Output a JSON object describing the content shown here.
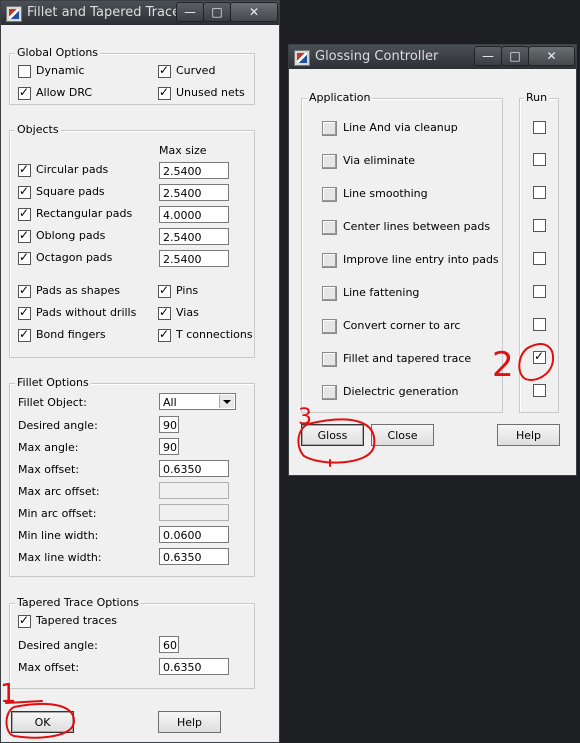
{
  "fillet_window": {
    "title": "Fillet and Tapered Trace",
    "global_options": {
      "label": "Global Options",
      "dynamic": "Dynamic",
      "curved": "Curved",
      "allow_drc": "Allow DRC",
      "unused_nets": "Unused nets"
    },
    "objects": {
      "label": "Objects",
      "max_size_header": "Max size",
      "rows": [
        {
          "label": "Circular pads",
          "value": "2.5400",
          "checked": true
        },
        {
          "label": "Square pads",
          "value": "2.5400",
          "checked": true
        },
        {
          "label": "Rectangular pads",
          "value": "4.0000",
          "checked": true
        },
        {
          "label": "Oblong pads",
          "value": "2.5400",
          "checked": true
        },
        {
          "label": "Octagon pads",
          "value": "2.5400",
          "checked": true
        }
      ],
      "pads_as_shapes": "Pads as shapes",
      "pins": "Pins",
      "pads_without_drills": "Pads without drills",
      "vias": "Vias",
      "bond_fingers": "Bond fingers",
      "t_connections": "T connections"
    },
    "fillet_options": {
      "label": "Fillet Options",
      "fillet_object_label": "Fillet Object:",
      "fillet_object_value": "All",
      "desired_angle_label": "Desired angle:",
      "desired_angle": "90",
      "max_angle_label": "Max angle:",
      "max_angle": "90",
      "max_offset_label": "Max offset:",
      "max_offset": "0.6350",
      "max_arc_offset_label": "Max arc offset:",
      "min_arc_offset_label": "Min arc offset:",
      "min_line_width_label": "Min line width:",
      "min_line_width": "0.0600",
      "max_line_width_label": "Max line width:",
      "max_line_width": "0.6350"
    },
    "tapered_options": {
      "label": "Tapered Trace Options",
      "tapered_traces": "Tapered traces",
      "desired_angle_label": "Desired angle:",
      "desired_angle": "60",
      "max_offset_label": "Max offset:",
      "max_offset": "0.6350"
    },
    "ok_label": "OK",
    "help_label": "Help"
  },
  "glossing_window": {
    "title": "Glossing Controller",
    "application_label": "Application",
    "run_label": "Run",
    "items": [
      {
        "label": "Line And via cleanup",
        "run": false
      },
      {
        "label": "Via eliminate",
        "run": false
      },
      {
        "label": "Line smoothing",
        "run": false
      },
      {
        "label": "Center lines between pads",
        "run": false
      },
      {
        "label": "Improve line entry into pads",
        "run": false
      },
      {
        "label": "Line fattening",
        "run": false
      },
      {
        "label": "Convert corner to arc",
        "run": false
      },
      {
        "label": "Fillet and tapered trace",
        "run": true
      },
      {
        "label": "Dielectric generation",
        "run": false
      }
    ],
    "gloss_label": "Gloss",
    "close_label": "Close",
    "help_label": "Help"
  },
  "annotations": {
    "one": "1",
    "two": "2",
    "three": "3",
    "color": "#e01010"
  },
  "titlebar_glyphs": {
    "minimize": "—",
    "maximize": "□",
    "close": "✕"
  }
}
